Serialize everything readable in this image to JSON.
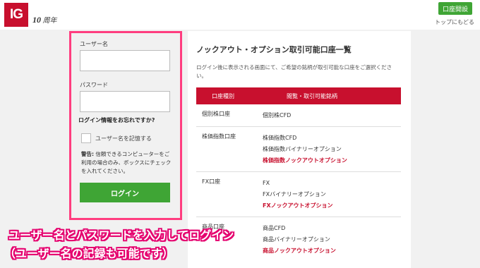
{
  "header": {
    "logo_text": "IG",
    "anniv_num": "10",
    "anniv_text": "周年",
    "open_account": "口座開設",
    "back_to_top": "トップにもどる"
  },
  "login": {
    "username_label": "ユーザー名",
    "password_label": "パスワード",
    "forgot": "ログイン情報をお忘れですか?",
    "remember": "ユーザー名を記憶する",
    "warning_bold": "警告:",
    "warning_text": " 信頼できるコンピューターをご利用の場合のみ、ボックスにチェックを入れてください。",
    "login_button": "ログイン"
  },
  "panel": {
    "title": "ノックアウト・オプション取引可能口座一覧",
    "description": "ログイン後に表示される画面にて、ご希望の銘柄が取引可能な口座をご選択ください。",
    "col_account": "口座種別",
    "col_products": "閲覧・取引可能銘柄",
    "rows": [
      {
        "type": "個別株口座",
        "products": [
          "個別株CFD"
        ],
        "knockout": ""
      },
      {
        "type": "株価指数口座",
        "products": [
          "株価指数CFD",
          "株価指数バイナリーオプション"
        ],
        "knockout": "株価指数ノックアウトオプション"
      },
      {
        "type": "FX口座",
        "products": [
          "FX",
          "FXバイナリーオプション"
        ],
        "knockout": "FXノックアウトオプション"
      },
      {
        "type": "商品口座",
        "products": [
          "商品CFD",
          "商品バイナリーオプション"
        ],
        "knockout": "商品ノックアウトオプション"
      }
    ]
  },
  "annotation": {
    "line1": "ユーザー名とパスワードを入力してログイン",
    "line2": "（ユーザー名の記録も可能です）"
  },
  "colors": {
    "brand_red": "#c8102e",
    "green": "#3fa535",
    "highlight_pink": "#ff3d7f"
  }
}
